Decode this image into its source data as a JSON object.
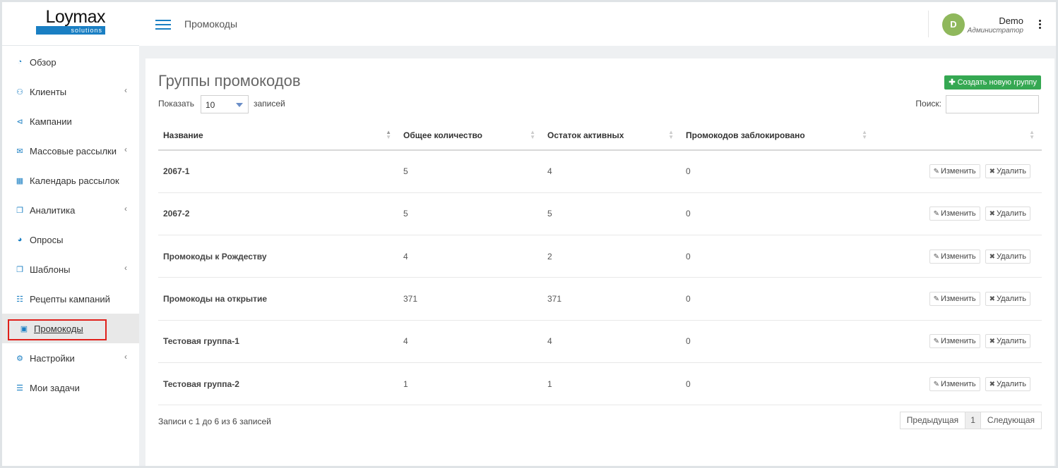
{
  "brand": {
    "logo_word": "Loymax",
    "logo_sub": "solutions"
  },
  "sidebar": {
    "items": [
      {
        "label": "Обзор",
        "icon": "dashboard-icon",
        "glyph": "◔",
        "has_chevron": false
      },
      {
        "label": "Клиенты",
        "icon": "users-icon",
        "glyph": "⚇",
        "has_chevron": true
      },
      {
        "label": "Кампании",
        "icon": "share-icon",
        "glyph": "⊲",
        "has_chevron": false
      },
      {
        "label": "Массовые рассылки",
        "icon": "envelope-icon",
        "glyph": "✉",
        "has_chevron": true
      },
      {
        "label": "Календарь рассылок",
        "icon": "calendar-icon",
        "glyph": "▦",
        "has_chevron": false
      },
      {
        "label": "Аналитика",
        "icon": "clone-icon",
        "glyph": "❐",
        "has_chevron": true
      },
      {
        "label": "Опросы",
        "icon": "pie-chart-icon",
        "glyph": "◕",
        "has_chevron": false
      },
      {
        "label": "Шаблоны",
        "icon": "clone-icon",
        "glyph": "❐",
        "has_chevron": true
      },
      {
        "label": "Рецепты кампаний",
        "icon": "sitemap-icon",
        "glyph": "☷",
        "has_chevron": false
      },
      {
        "label": "Промокоды",
        "icon": "gift-icon",
        "glyph": "▣",
        "has_chevron": false,
        "active": true
      },
      {
        "label": "Настройки",
        "icon": "gear-icon",
        "glyph": "⚙",
        "has_chevron": true
      },
      {
        "label": "Мои задачи",
        "icon": "tasks-icon",
        "glyph": "☰",
        "has_chevron": false
      }
    ],
    "chevron": "‹"
  },
  "header": {
    "title": "Промокоды",
    "user": {
      "initial": "D",
      "name": "Demo",
      "role": "Администратор"
    }
  },
  "main": {
    "title": "Группы промокодов",
    "create_button": "Создать новую группу",
    "length": {
      "prefix": "Показать",
      "value": "10",
      "suffix": "записей"
    },
    "search": {
      "label": "Поиск:",
      "value": ""
    },
    "columns": [
      "Название",
      "Общее количество",
      "Остаток активных",
      "Промокодов заблокировано",
      ""
    ],
    "rows": [
      {
        "name": "2067-1",
        "total": "5",
        "active": "4",
        "blocked": "0"
      },
      {
        "name": "2067-2",
        "total": "5",
        "active": "5",
        "blocked": "0"
      },
      {
        "name": "Промокоды к Рождеству",
        "total": "4",
        "active": "2",
        "blocked": "0"
      },
      {
        "name": "Промокоды на открытие",
        "total": "371",
        "active": "371",
        "blocked": "0"
      },
      {
        "name": "Тестовая группа-1",
        "total": "4",
        "active": "4",
        "blocked": "0"
      },
      {
        "name": "Тестовая группа-2",
        "total": "1",
        "active": "1",
        "blocked": "0"
      }
    ],
    "edit_label": "Изменить",
    "delete_label": "Удалить",
    "info": "Записи с 1 до 6 из 6 записей",
    "pager": {
      "prev": "Предыдущая",
      "current": "1",
      "next": "Следующая"
    }
  },
  "colors": {
    "accent": "#1a7fc3",
    "create": "#35a852",
    "avatar": "#8fb85c",
    "highlight": "#e0201b"
  }
}
